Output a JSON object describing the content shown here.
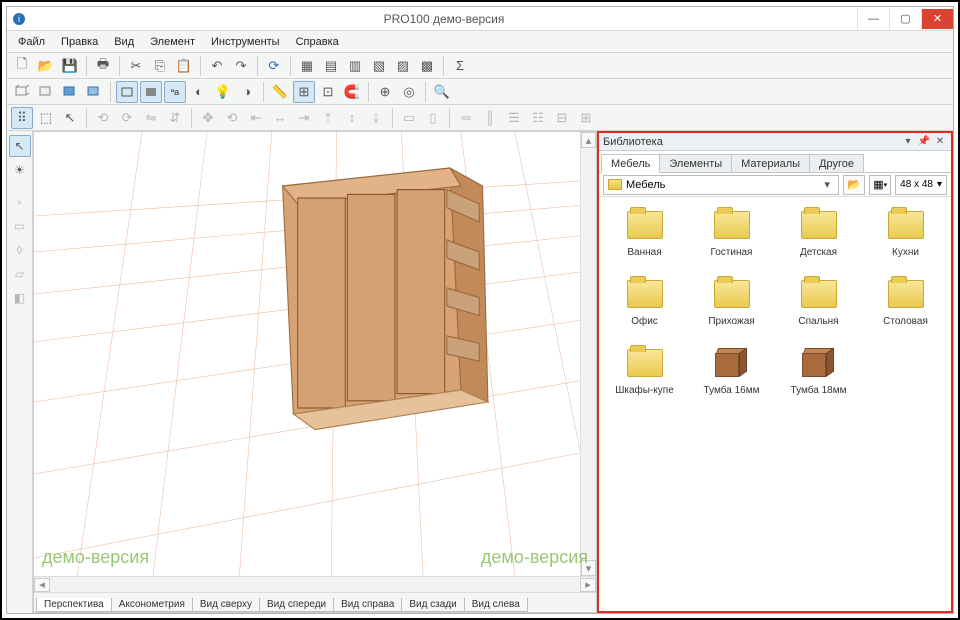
{
  "window": {
    "title": "PRO100 демо-версия"
  },
  "menu": {
    "file": "Файл",
    "edit": "Правка",
    "view": "Вид",
    "element": "Элемент",
    "tools": "Инструменты",
    "help": "Справка"
  },
  "watermark": "демо-версия",
  "view_tabs": {
    "perspective": "Перспектива",
    "axonometry": "Аксонометрия",
    "top": "Вид сверху",
    "front": "Вид спереди",
    "right": "Вид справа",
    "back": "Вид сзади",
    "left": "Вид слева"
  },
  "library": {
    "title": "Библиотека",
    "tabs": {
      "furniture": "Мебель",
      "elements": "Элементы",
      "materials": "Материалы",
      "other": "Другое"
    },
    "path": "Мебель",
    "thumb_size": "48 x  48",
    "items": [
      {
        "label": "Ванная",
        "kind": "folder"
      },
      {
        "label": "Гостиная",
        "kind": "folder"
      },
      {
        "label": "Детская",
        "kind": "folder"
      },
      {
        "label": "Кухни",
        "kind": "folder"
      },
      {
        "label": "Офис",
        "kind": "folder"
      },
      {
        "label": "Прихожая",
        "kind": "folder"
      },
      {
        "label": "Спальня",
        "kind": "folder"
      },
      {
        "label": "Столовая",
        "kind": "folder"
      },
      {
        "label": "Шкафы-купе",
        "kind": "folder"
      },
      {
        "label": "Тумба 16мм",
        "kind": "furniture"
      },
      {
        "label": "Тумба 18мм",
        "kind": "furniture"
      }
    ]
  }
}
